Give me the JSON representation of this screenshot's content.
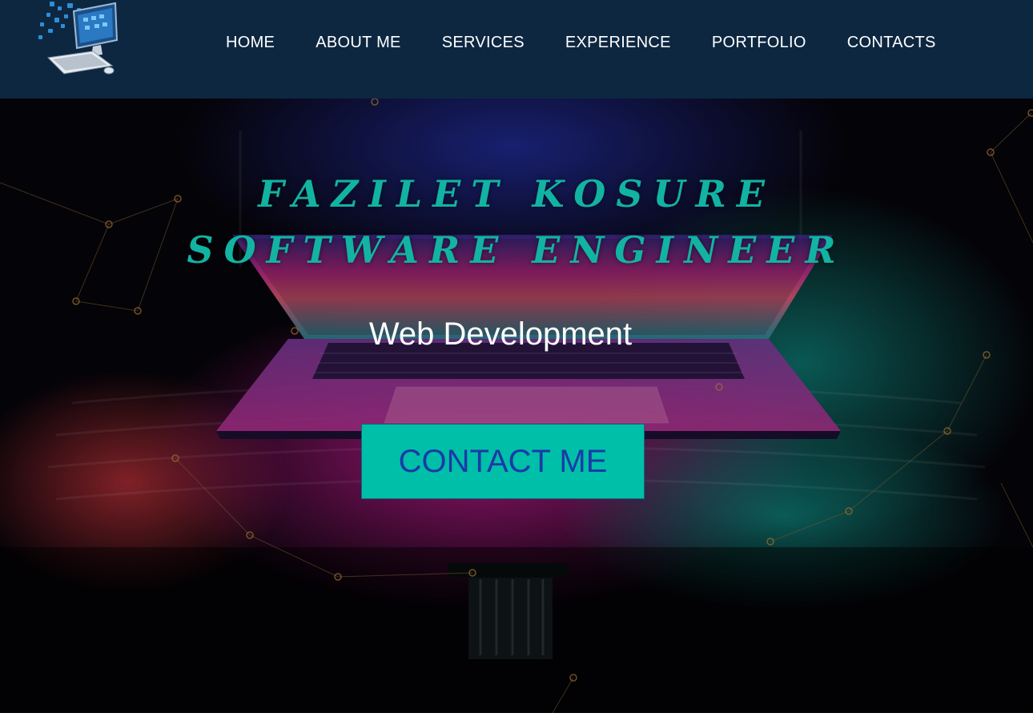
{
  "header": {
    "logo_icon": "computer-cloud-logo-icon",
    "nav": [
      {
        "label": "HOME"
      },
      {
        "label": "ABOUT ME"
      },
      {
        "label": "SERVICES"
      },
      {
        "label": "EXPERIENCE"
      },
      {
        "label": "PORTFOLIO"
      },
      {
        "label": "CONTACTS"
      }
    ]
  },
  "hero": {
    "name": "FAZILET KOSURE",
    "role": "SOFTWARE ENGINEER",
    "tagline": "Web Development",
    "cta_label": "CONTACT ME",
    "background_icon": "laptop-neon-background"
  },
  "colors": {
    "navbar_bg": "#0d2741",
    "title_teal": "#12b3a3",
    "cta_bg": "#00bfa8",
    "cta_text": "#1b3aa8"
  }
}
